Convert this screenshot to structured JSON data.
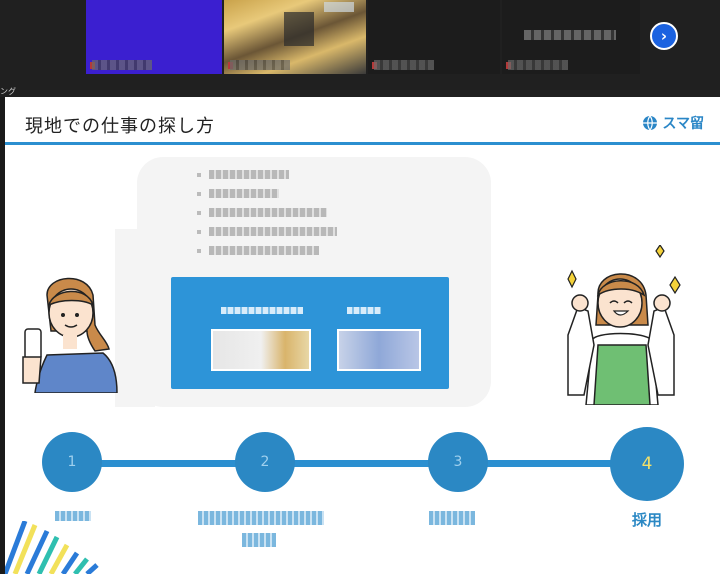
{
  "top_strip": {
    "label": "ング",
    "next_button_icon": "chevron-right-icon"
  },
  "slide": {
    "title": "現地での仕事の探し方",
    "brand": "スマ留",
    "brand_icon": "globe-icon",
    "colors": {
      "primary": "#2b8fd0",
      "step": "#2b88c4",
      "active_number": "#f2e06a"
    }
  },
  "steps": [
    {
      "number": "1",
      "label": ""
    },
    {
      "number": "2",
      "label": ""
    },
    {
      "number": "3",
      "label": ""
    },
    {
      "number": "4",
      "label": "採用"
    }
  ]
}
